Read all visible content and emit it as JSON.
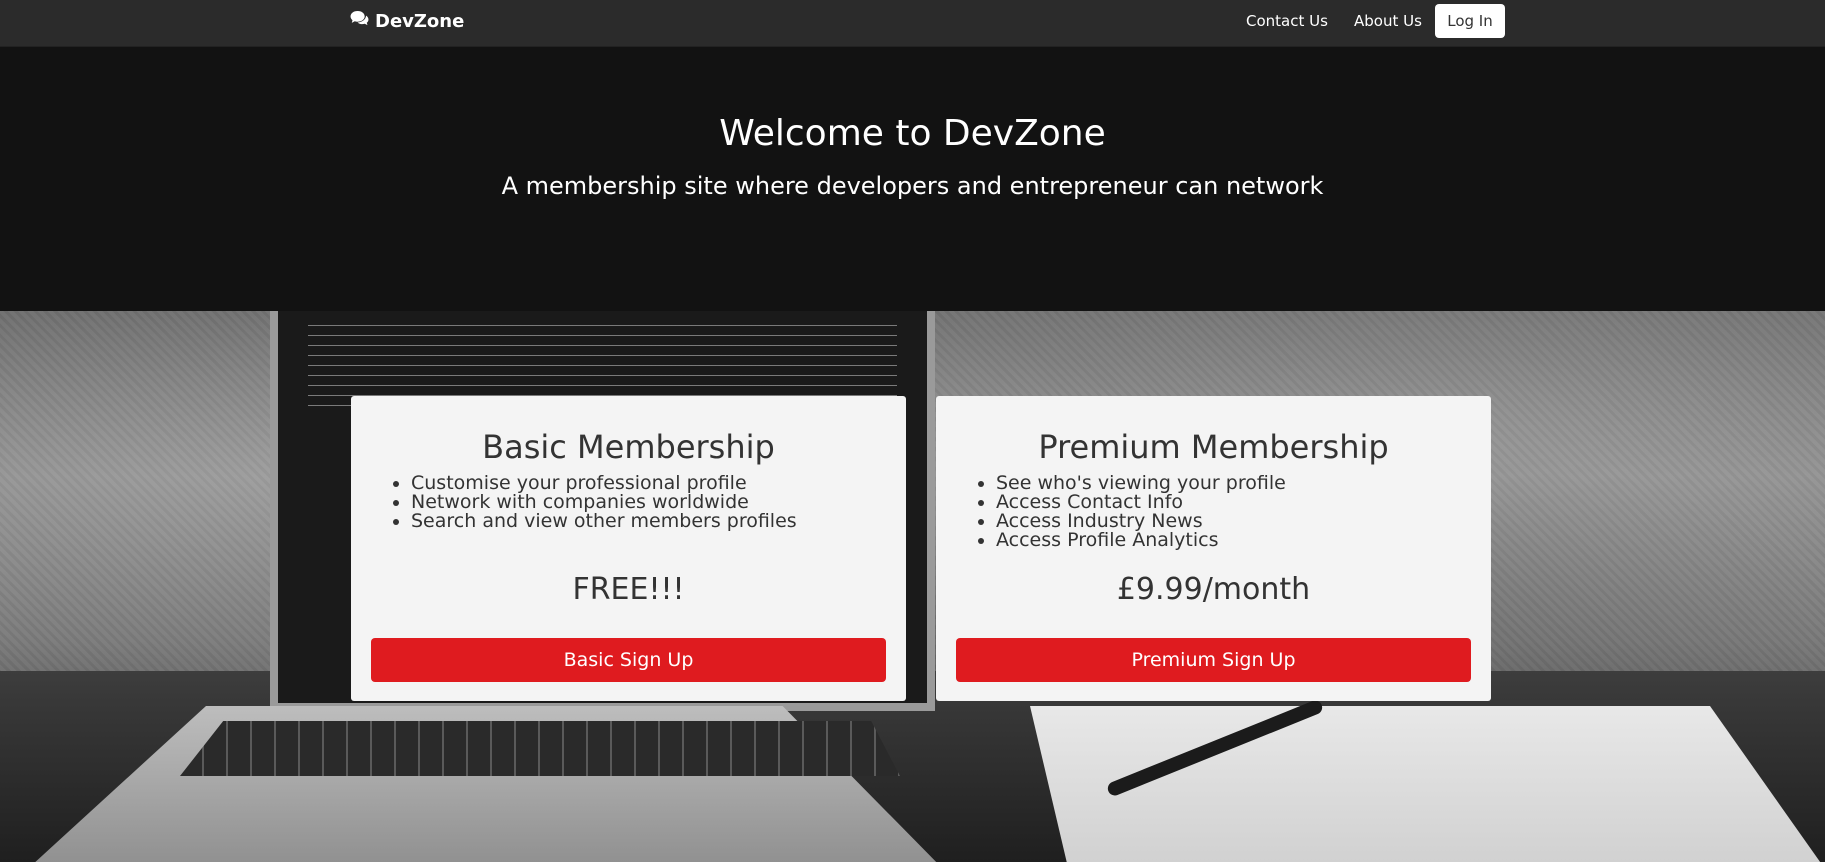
{
  "navbar": {
    "brand": "DevZone",
    "brand_icon": "comments-icon",
    "links": [
      {
        "label": "Contact Us"
      },
      {
        "label": "About Us"
      }
    ],
    "login_label": "Log In"
  },
  "hero": {
    "title": "Welcome to DevZone",
    "subtitle": "A membership site where developers and entrepreneur can network"
  },
  "plans": [
    {
      "title": "Basic Membership",
      "features": [
        "Customise your professional profile",
        "Network with companies worldwide",
        "Search and view other members profiles"
      ],
      "price": "FREE!!!",
      "button_label": "Basic Sign Up"
    },
    {
      "title": "Premium Membership",
      "features": [
        "See who's viewing your profile",
        "Access Contact Info",
        "Access Industry News",
        "Access Profile Analytics"
      ],
      "price": "£9.99/month",
      "button_label": "Premium Sign Up"
    }
  ],
  "colors": {
    "navbar_bg": "#2b2b2b",
    "hero_bg": "#121212",
    "card_bg": "#f4f4f4",
    "accent_red": "#df1b1f"
  }
}
